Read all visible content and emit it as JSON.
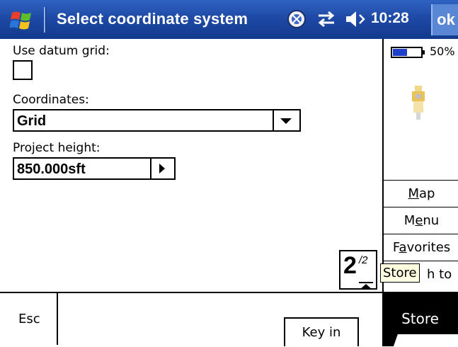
{
  "titlebar": {
    "title": "Select coordinate system",
    "time": "10:28",
    "ok_label": "ok",
    "icons": [
      "windows-start-icon",
      "satellite-icon",
      "connectivity-icon",
      "volume-icon"
    ]
  },
  "form": {
    "datum_grid_label": "Use datum grid:",
    "datum_grid_checked": false,
    "coordinates_label": "Coordinates:",
    "coordinates_value": "Grid",
    "project_height_label": "Project height:",
    "project_height_value": "850.000sft"
  },
  "pager": {
    "current": "2",
    "total": "/2"
  },
  "side_panel": {
    "battery_percent": "50%",
    "battery_level": 0.5,
    "buttons": [
      "Map",
      "Menu",
      "Favorites"
    ],
    "partial_text": "h to",
    "tooltip": "Store"
  },
  "bottom": {
    "esc_label": "Esc",
    "keyin_label": "Key in",
    "store_label": "Store"
  },
  "colors": {
    "titlebar": "#1e4aa6",
    "ok_button": "#5a86d6",
    "tooltip_bg": "#ffffe1",
    "battery_fill": "#1e3fcc"
  }
}
